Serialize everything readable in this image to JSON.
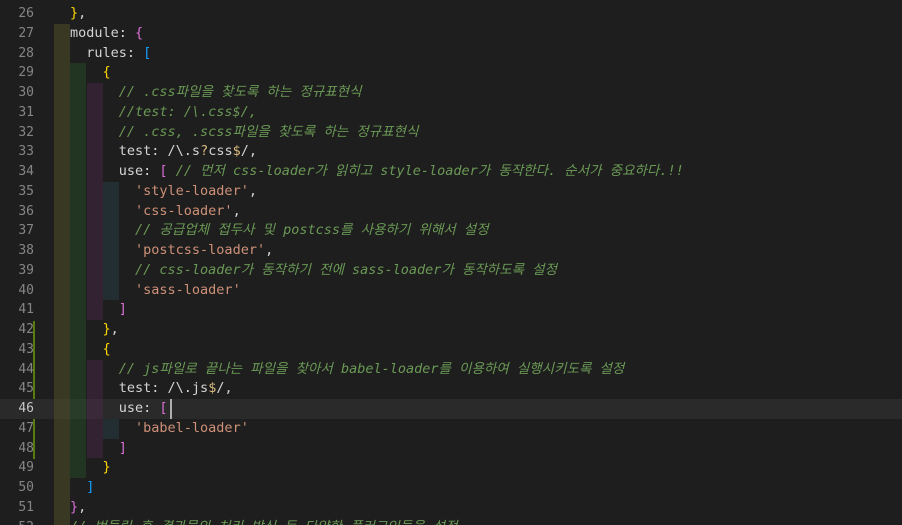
{
  "editor": {
    "active_line": 46,
    "lines": [
      {
        "num": 26,
        "tokens": [
          {
            "t": "}",
            "c": "b1"
          },
          {
            "t": ",",
            "c": "punc"
          }
        ]
      },
      {
        "num": 27,
        "tokens": [
          {
            "t": "module",
            "c": "key"
          },
          {
            "t": ": ",
            "c": "punc"
          },
          {
            "t": "{",
            "c": "b2"
          }
        ]
      },
      {
        "num": 28,
        "tokens": [
          {
            "t": "  rules",
            "c": "key"
          },
          {
            "t": ": ",
            "c": "punc"
          },
          {
            "t": "[",
            "c": "b3"
          }
        ]
      },
      {
        "num": 29,
        "tokens": [
          {
            "t": "    ",
            "c": "plain"
          },
          {
            "t": "{",
            "c": "b1"
          }
        ]
      },
      {
        "num": 30,
        "tokens": [
          {
            "t": "      // .css파일을 찾도록 하는 정규표현식",
            "c": "comment"
          }
        ]
      },
      {
        "num": 31,
        "tokens": [
          {
            "t": "      //test: /\\.css$/,",
            "c": "comment"
          }
        ]
      },
      {
        "num": 32,
        "tokens": [
          {
            "t": "      // .css, .scss파일을 찾도록 하는 정규표현식",
            "c": "comment"
          }
        ]
      },
      {
        "num": 33,
        "tokens": [
          {
            "t": "      test",
            "c": "key"
          },
          {
            "t": ": ",
            "c": "punc"
          },
          {
            "t": "/\\.s",
            "c": "regex"
          },
          {
            "t": "?",
            "c": "regex-op"
          },
          {
            "t": "css",
            "c": "regex"
          },
          {
            "t": "$",
            "c": "regex-op"
          },
          {
            "t": "/",
            "c": "regex"
          },
          {
            "t": ",",
            "c": "punc"
          }
        ]
      },
      {
        "num": 34,
        "tokens": [
          {
            "t": "      use",
            "c": "key"
          },
          {
            "t": ": ",
            "c": "punc"
          },
          {
            "t": "[",
            "c": "b2"
          },
          {
            "t": " // 먼저 css-loader가 읽히고 style-loader가 동작한다. 순서가 중요하다.!!",
            "c": "comment"
          }
        ]
      },
      {
        "num": 35,
        "tokens": [
          {
            "t": "        ",
            "c": "plain"
          },
          {
            "t": "'style-loader'",
            "c": "str"
          },
          {
            "t": ",",
            "c": "punc"
          }
        ]
      },
      {
        "num": 36,
        "tokens": [
          {
            "t": "        ",
            "c": "plain"
          },
          {
            "t": "'css-loader'",
            "c": "str"
          },
          {
            "t": ",",
            "c": "punc"
          }
        ]
      },
      {
        "num": 37,
        "tokens": [
          {
            "t": "        // 공급업체 접두사 및 postcss를 사용하기 위해서 설정",
            "c": "comment"
          }
        ]
      },
      {
        "num": 38,
        "tokens": [
          {
            "t": "        ",
            "c": "plain"
          },
          {
            "t": "'postcss-loader'",
            "c": "str"
          },
          {
            "t": ",",
            "c": "punc"
          }
        ]
      },
      {
        "num": 39,
        "tokens": [
          {
            "t": "        // css-loader가 동작하기 전에 sass-loader가 동작하도록 설정",
            "c": "comment"
          }
        ]
      },
      {
        "num": 40,
        "tokens": [
          {
            "t": "        ",
            "c": "plain"
          },
          {
            "t": "'sass-loader'",
            "c": "str"
          }
        ]
      },
      {
        "num": 41,
        "tokens": [
          {
            "t": "      ",
            "c": "plain"
          },
          {
            "t": "]",
            "c": "b2"
          }
        ]
      },
      {
        "num": 42,
        "tokens": [
          {
            "t": "    ",
            "c": "plain"
          },
          {
            "t": "}",
            "c": "b1"
          },
          {
            "t": ",",
            "c": "punc"
          }
        ]
      },
      {
        "num": 43,
        "tokens": [
          {
            "t": "    ",
            "c": "plain"
          },
          {
            "t": "{",
            "c": "b1"
          }
        ]
      },
      {
        "num": 44,
        "tokens": [
          {
            "t": "      // js파일로 끝나는 파일을 찾아서 babel-loader를 이용하여 실행시키도록 설정",
            "c": "comment"
          }
        ]
      },
      {
        "num": 45,
        "tokens": [
          {
            "t": "      test",
            "c": "key"
          },
          {
            "t": ": ",
            "c": "punc"
          },
          {
            "t": "/\\.js",
            "c": "regex"
          },
          {
            "t": "$",
            "c": "regex-op"
          },
          {
            "t": "/",
            "c": "regex"
          },
          {
            "t": ",",
            "c": "punc"
          }
        ]
      },
      {
        "num": 46,
        "tokens": [
          {
            "t": "      use",
            "c": "key"
          },
          {
            "t": ": ",
            "c": "punc"
          },
          {
            "t": "[",
            "c": "b2"
          }
        ]
      },
      {
        "num": 47,
        "tokens": [
          {
            "t": "        ",
            "c": "plain"
          },
          {
            "t": "'babel-loader'",
            "c": "str"
          }
        ]
      },
      {
        "num": 48,
        "tokens": [
          {
            "t": "      ",
            "c": "plain"
          },
          {
            "t": "]",
            "c": "b2"
          }
        ]
      },
      {
        "num": 49,
        "tokens": [
          {
            "t": "    ",
            "c": "plain"
          },
          {
            "t": "}",
            "c": "b1"
          }
        ]
      },
      {
        "num": 50,
        "tokens": [
          {
            "t": "  ",
            "c": "plain"
          },
          {
            "t": "]",
            "c": "b3"
          }
        ]
      },
      {
        "num": 51,
        "tokens": [
          {
            "t": "}",
            "c": "b2"
          },
          {
            "t": ",",
            "c": "punc"
          }
        ]
      },
      {
        "num": 52,
        "tokens": [
          {
            "t": "// 번들링 후 결과물의 처리 방식 등 다양한 플러그인들을 설정",
            "c": "comment"
          }
        ]
      }
    ]
  }
}
